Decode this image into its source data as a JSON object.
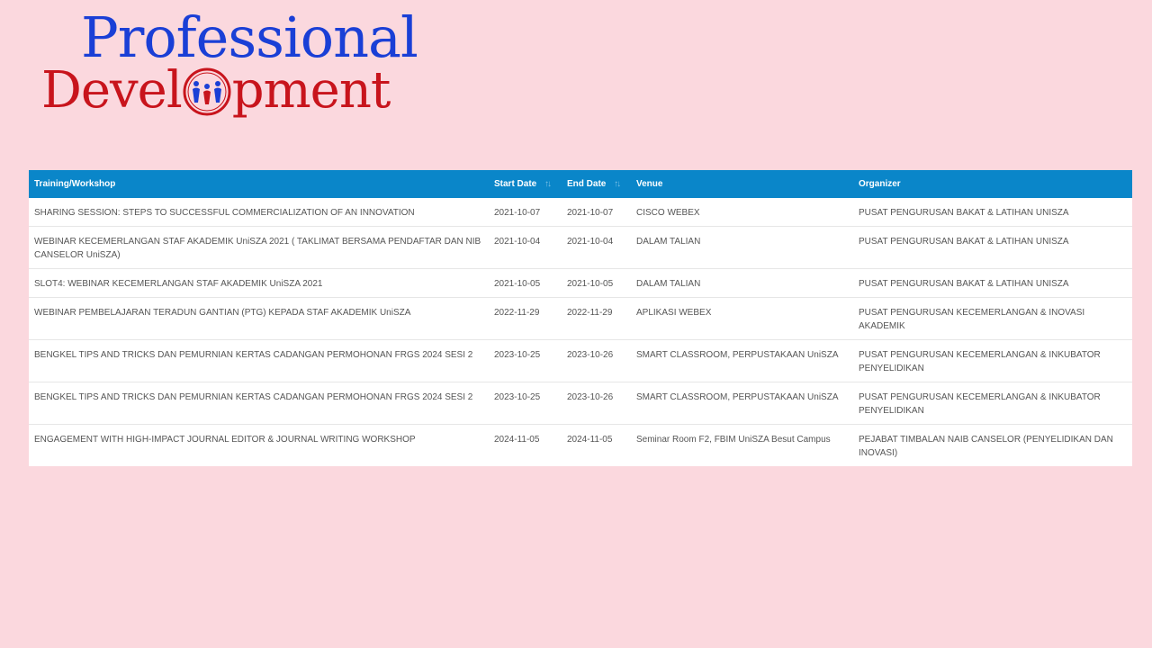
{
  "logo": {
    "line1": "Professional",
    "line2_before": "Devel",
    "line2_after": "pment",
    "colors": {
      "top": "#1a3fd6",
      "bottom": "#c8141c"
    }
  },
  "table": {
    "headers": {
      "training": "Training/Workshop",
      "start": "Start Date",
      "end": "End Date",
      "venue": "Venue",
      "organizer": "Organizer"
    },
    "sort_glyph": "↑↓",
    "rows": [
      {
        "training": "SHARING SESSION: STEPS TO SUCCESSFUL COMMERCIALIZATION OF AN INNOVATION",
        "start": "2021-10-07",
        "end": "2021-10-07",
        "venue": "CISCO WEBEX",
        "organizer": "PUSAT PENGURUSAN BAKAT & LATIHAN UNISZA"
      },
      {
        "training": "WEBINAR KECEMERLANGAN STAF AKADEMIK UniSZA 2021 ( TAKLIMAT BERSAMA PENDAFTAR DAN NIB CANSELOR UniSZA)",
        "start": "2021-10-04",
        "end": "2021-10-04",
        "venue": "DALAM TALIAN",
        "organizer": "PUSAT PENGURUSAN BAKAT & LATIHAN UNISZA"
      },
      {
        "training": "SLOT4: WEBINAR KECEMERLANGAN STAF AKADEMIK UniSZA 2021",
        "start": "2021-10-05",
        "end": "2021-10-05",
        "venue": "DALAM TALIAN",
        "organizer": "PUSAT PENGURUSAN BAKAT & LATIHAN UNISZA"
      },
      {
        "training": "WEBINAR PEMBELAJARAN TERADUN GANTIAN (PTG) KEPADA STAF AKADEMIK UniSZA",
        "start": "2022-11-29",
        "end": "2022-11-29",
        "venue": "APLIKASI WEBEX",
        "organizer": "PUSAT PENGURUSAN KECEMERLANGAN & INOVASI AKADEMIK"
      },
      {
        "training": "BENGKEL TIPS AND TRICKS DAN PEMURNIAN KERTAS CADANGAN PERMOHONAN FRGS 2024 SESI 2",
        "start": "2023-10-25",
        "end": "2023-10-26",
        "venue": "SMART CLASSROOM, PERPUSTAKAAN UniSZA",
        "organizer": "PUSAT PENGURUSAN KECEMERLANGAN & INKUBATOR PENYELIDIKAN"
      },
      {
        "training": "BENGKEL TIPS AND TRICKS DAN PEMURNIAN KERTAS CADANGAN PERMOHONAN FRGS 2024 SESI 2",
        "start": "2023-10-25",
        "end": "2023-10-26",
        "venue": "SMART CLASSROOM, PERPUSTAKAAN UniSZA",
        "organizer": "PUSAT PENGURUSAN KECEMERLANGAN & INKUBATOR PENYELIDIKAN"
      },
      {
        "training": "ENGAGEMENT WITH HIGH-IMPACT JOURNAL EDITOR & JOURNAL WRITING WORKSHOP",
        "start": "2024-11-05",
        "end": "2024-11-05",
        "venue": "Seminar Room F2, FBIM UniSZA Besut Campus",
        "organizer": "PEJABAT TIMBALAN NAIB CANSELOR (PENYELIDIKAN DAN INOVASI)"
      }
    ]
  }
}
